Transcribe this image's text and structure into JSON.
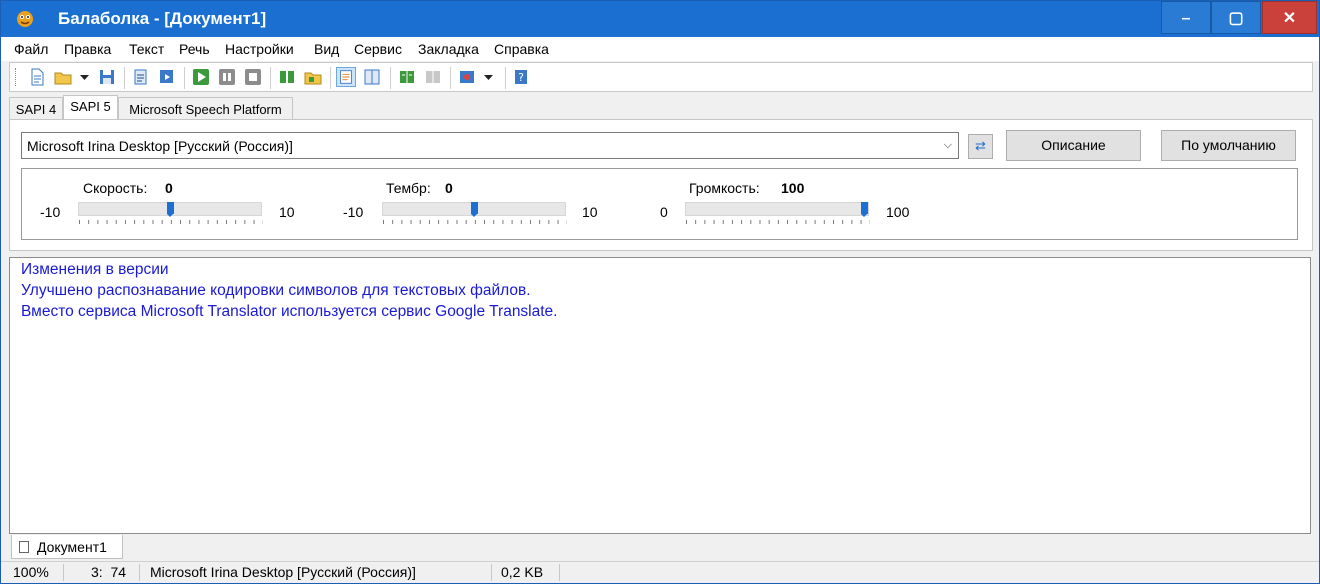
{
  "window": {
    "title": "Балаболка - [Документ1]",
    "controls": {
      "minimize": "–",
      "maximize": "▢",
      "close": "✕"
    }
  },
  "menu": [
    "Файл",
    "Правка",
    "Текст",
    "Речь",
    "Настройки",
    "Вид",
    "Сервис",
    "Закладка",
    "Справка"
  ],
  "toolbar": {
    "buttons": [
      "new-file-icon",
      "open-folder-icon",
      "dropdown-arrow-icon",
      "save-icon",
      "read-clipboard-icon",
      "save-audio-icon",
      "play-icon",
      "pause-icon",
      "stop-icon",
      "book-next-icon",
      "folder-audio-icon",
      "notes-icon",
      "split-text-icon",
      "dictionary-icon",
      "bookmark-icon",
      "translate-icon",
      "help-icon"
    ]
  },
  "tabs": [
    "SAPI 4",
    "SAPI 5",
    "Microsoft Speech Platform"
  ],
  "voice": {
    "selected": "Microsoft Irina Desktop [Русский (Россия)]",
    "description_button": "Описание",
    "default_button": "По умолчанию"
  },
  "sliders": {
    "rate": {
      "label": "Скорость:",
      "value": "0",
      "min": "-10",
      "max": "10",
      "level": 0.5
    },
    "pitch": {
      "label": "Тембр:",
      "value": "0",
      "min": "-10",
      "max": "10",
      "level": 0.5
    },
    "volume": {
      "label": "Громкость:",
      "value": "100",
      "min": "0",
      "max": "100",
      "level": 1.0
    }
  },
  "editor": {
    "lines": [
      "Изменения в версии",
      "Улучшено распознавание кодировки символов для текстовых файлов.",
      "Вместо сервиса Microsoft Translator используется сервис Google Translate."
    ],
    "text_color": "#1a1ad4"
  },
  "document_tab": "Документ1",
  "status": {
    "zoom": "100%",
    "position": "3:  74",
    "voice": "Microsoft Irina Desktop [Русский (Россия)]",
    "size": "0,2 KB"
  },
  "colors": {
    "titlebar": "#1b6fd0",
    "close_button": "#c9413a",
    "slider_thumb": "#1d6fd1"
  }
}
